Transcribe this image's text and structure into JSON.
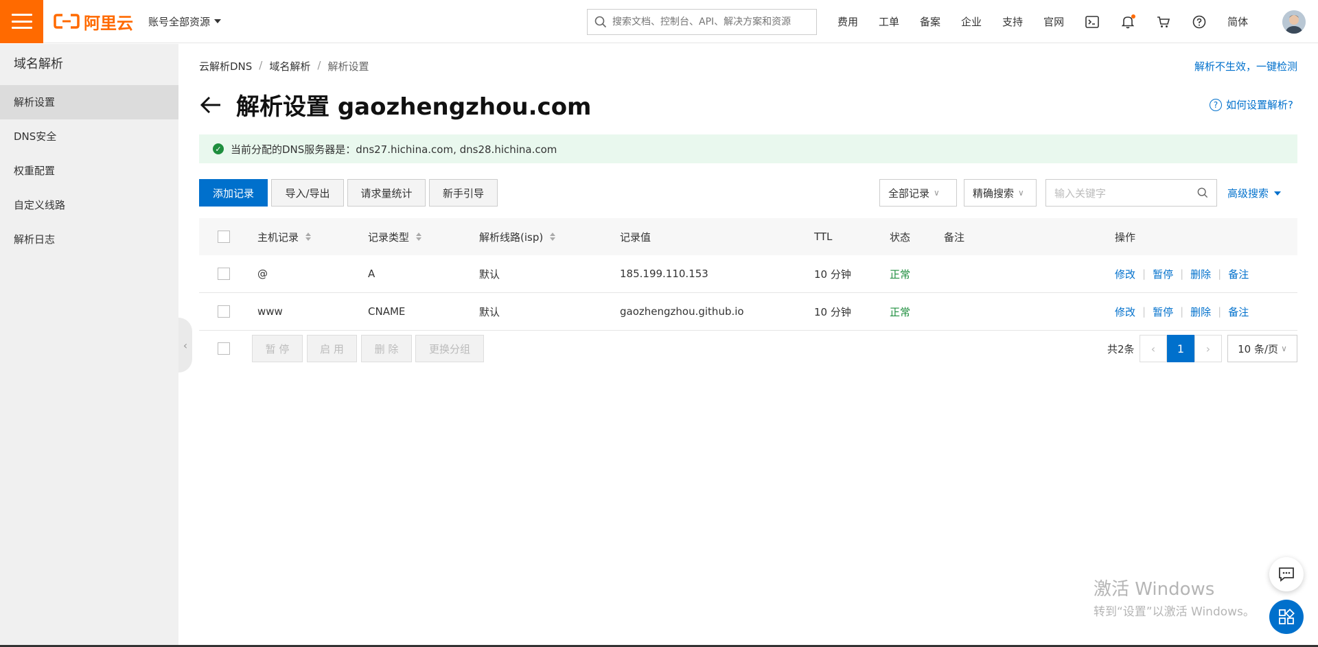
{
  "header": {
    "logo_text": "阿里云",
    "account_label": "账号全部资源",
    "search_placeholder": "搜索文档、控制台、API、解决方案和资源",
    "nav": [
      "费用",
      "工单",
      "备案",
      "企业",
      "支持",
      "官网"
    ],
    "lang": "简体",
    "icons": [
      "terminal-icon",
      "bell-icon",
      "cart-icon",
      "help-icon"
    ]
  },
  "sidebar": {
    "title": "域名解析",
    "items": [
      {
        "label": "解析设置",
        "active": true
      },
      {
        "label": "DNS安全",
        "active": false
      },
      {
        "label": "权重配置",
        "active": false
      },
      {
        "label": "自定义线路",
        "active": false
      },
      {
        "label": "解析日志",
        "active": false
      }
    ]
  },
  "breadcrumb": [
    "云解析DNS",
    "域名解析",
    "解析设置"
  ],
  "quick_check": "解析不生效，一键检测",
  "page_title": "解析设置 gaozhengzhou.com",
  "how_to": "如何设置解析?",
  "dns_notice": "当前分配的DNS服务器是：dns27.hichina.com, dns28.hichina.com",
  "toolbar": {
    "add": "添加记录",
    "import_export": "导入/导出",
    "stats": "请求量统计",
    "guide": "新手引导",
    "filter_all": "全部记录",
    "exact_search": "精确搜索",
    "keyword_placeholder": "输入关键字",
    "advanced": "高级搜索"
  },
  "table": {
    "headers": {
      "host": "主机记录",
      "type": "记录类型",
      "line": "解析线路(isp)",
      "value": "记录值",
      "ttl": "TTL",
      "status": "状态",
      "remark": "备注",
      "ops": "操作"
    },
    "rows": [
      {
        "host": "@",
        "type": "A",
        "line": "默认",
        "value": "185.199.110.153",
        "ttl": "10 分钟",
        "status": "正常"
      },
      {
        "host": "www",
        "type": "CNAME",
        "line": "默认",
        "value": "gaozhengzhou.github.io",
        "ttl": "10 分钟",
        "status": "正常"
      }
    ],
    "ops": {
      "edit": "修改",
      "pause": "暂停",
      "delete": "删除",
      "remark": "备注"
    }
  },
  "bulk": {
    "pause": "暂 停",
    "enable": "启 用",
    "delete": "删 除",
    "change_group": "更换分组"
  },
  "pager": {
    "total": "共2条",
    "current": "1",
    "page_size": "10 条/页"
  },
  "watermark": {
    "title": "激活 Windows",
    "sub": "转到“设置”以激活 Windows。"
  },
  "colors": {
    "brand": "#ff6a00",
    "primary": "#0070cc",
    "success": "#1e8e3e"
  }
}
